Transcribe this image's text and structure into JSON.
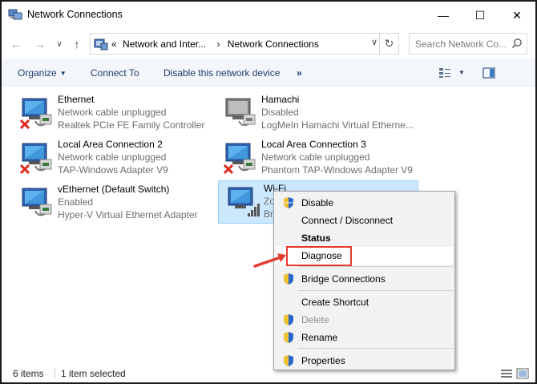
{
  "window": {
    "title": "Network Connections",
    "minimize": "—",
    "maximize": "☐",
    "close": "✕"
  },
  "nav": {
    "back": "←",
    "forward": "→",
    "recent": "∨",
    "up": "↑",
    "crumb_overflow": "«",
    "crumbs": [
      "Network and Inter...",
      "Network Connections"
    ],
    "crumb_sep": "›",
    "refresh": "↻",
    "search_placeholder": "Search Network Co..."
  },
  "toolbar": {
    "organize": "Organize",
    "connect_to": "Connect To",
    "disable_device": "Disable this network device",
    "more": "»",
    "dropdown_caret": "▼"
  },
  "connections": [
    {
      "name": "Ethernet",
      "status": "Network cable unplugged",
      "device": "Realtek PCIe FE Family Controller",
      "state": "unplugged"
    },
    {
      "name": "Hamachi",
      "status": "Disabled",
      "device": "LogMeIn Hamachi Virtual Etherne...",
      "state": "disabled"
    },
    {
      "name": "Local Area Connection 2",
      "status": "Network cable unplugged",
      "device": "TAP-Windows Adapter V9",
      "state": "unplugged"
    },
    {
      "name": "Local Area Connection 3",
      "status": "Network cable unplugged",
      "device": "Phantom TAP-Windows Adapter V9",
      "state": "unplugged"
    },
    {
      "name": "vEthernet (Default Switch)",
      "status": "Enabled",
      "device": "Hyper-V Virtual Ethernet Adapter",
      "state": "enabled"
    },
    {
      "name": "Wi-Fi",
      "status": "Zo",
      "device": "Br",
      "state": "wifi"
    }
  ],
  "context_menu": {
    "items": [
      {
        "label": "Disable",
        "shield": true
      },
      {
        "label": "Connect / Disconnect",
        "shield": false
      },
      {
        "label": "Status",
        "shield": false,
        "bold": true
      },
      {
        "label": "Diagnose",
        "shield": false,
        "highlighted": true
      },
      {
        "label": "Bridge Connections",
        "shield": true
      },
      {
        "label": "Create Shortcut",
        "shield": false
      },
      {
        "label": "Delete",
        "shield": true,
        "disabled": true
      },
      {
        "label": "Rename",
        "shield": true
      },
      {
        "label": "Properties",
        "shield": true
      }
    ]
  },
  "statusbar": {
    "count": "6 items",
    "selection": "1 item selected"
  },
  "colors": {
    "accent": "#1e3b6b",
    "selection": "#cce8ff",
    "annotation": "#e53a2f"
  }
}
